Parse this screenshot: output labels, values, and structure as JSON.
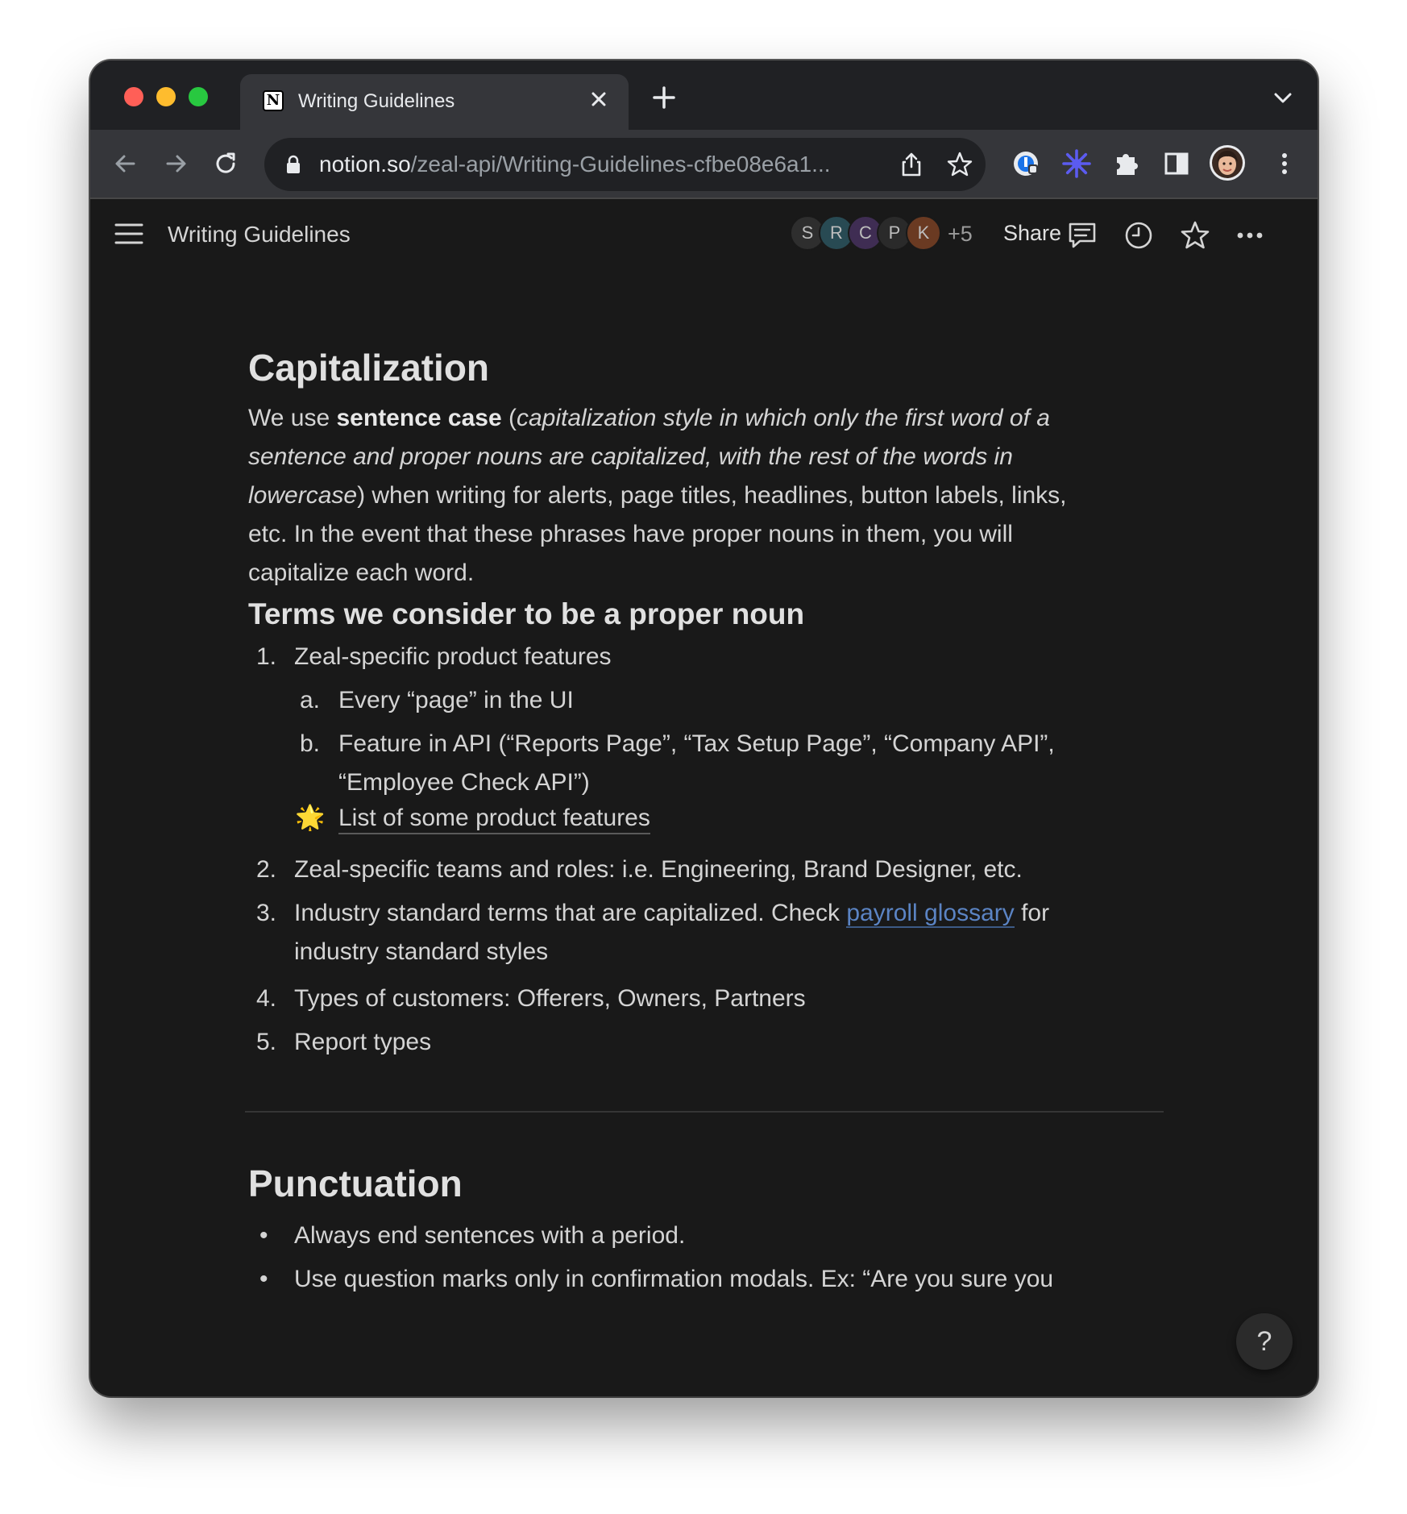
{
  "browser": {
    "tab_title": "Writing Guidelines",
    "tab_favicon": "N",
    "url_host": "notion.so",
    "url_path": "/zeal-api/Writing-Guidelines-cfbe08e6a1..."
  },
  "header": {
    "title": "Writing Guidelines",
    "avatars": [
      {
        "letter": "S",
        "color": "#2e2e2e"
      },
      {
        "letter": "R",
        "color": "#284a53"
      },
      {
        "letter": "C",
        "color": "#3f2d53"
      },
      {
        "letter": "P",
        "color": "#2a2a2a"
      },
      {
        "letter": "K",
        "color": "#6a3a22"
      }
    ],
    "more_count": "+5",
    "share_label": "Share"
  },
  "content": {
    "capitalization": {
      "heading": "Capitalization",
      "p_we_use": "We use ",
      "p_bold": "sentence case",
      "p_paren_open": " (",
      "p_italic_1": "capitalization style in which only the first word of a",
      "p_italic_2": "sentence and proper nouns are capitalized, with the rest of the words in",
      "p_italic_3": "lowercase",
      "p_rest_3": ") when writing for alerts, page titles, headlines, button labels, links,",
      "p_line_4": "etc. In the event that these phrases have proper nouns in them, you will",
      "p_line_5": "capitalize each word."
    },
    "proper_nouns": {
      "heading": "Terms we consider to be a proper noun",
      "items": [
        {
          "marker": "1.",
          "text": "Zeal-specific product features"
        },
        {
          "marker": "2.",
          "text": "Zeal-specific teams and roles: i.e. Engineering, Brand Designer, etc."
        },
        {
          "marker": "3.",
          "text_a": "Industry standard terms that are capitalized. Check ",
          "link": "payroll glossary",
          "text_b": " for",
          "text_c": "industry standard styles"
        },
        {
          "marker": "4.",
          "text": "Types of customers: Offerers, Owners, Partners"
        },
        {
          "marker": "5.",
          "text": "Report types"
        }
      ],
      "sub_items": [
        {
          "marker": "a.",
          "text": "Every “page” in the UI"
        },
        {
          "marker": "b.",
          "text_1": "Feature in API (“Reports Page”, “Tax Setup Page”, “Company API”,",
          "text_2": "“Employee Check API”)"
        }
      ],
      "page_link": {
        "emoji": "🌟",
        "label": "List of some product features"
      }
    },
    "punctuation": {
      "heading": "Punctuation",
      "bullets": [
        "Always end sentences with a period.",
        "Use question marks only in confirmation modals. Ex: “Are you sure you"
      ]
    }
  },
  "help_label": "?"
}
